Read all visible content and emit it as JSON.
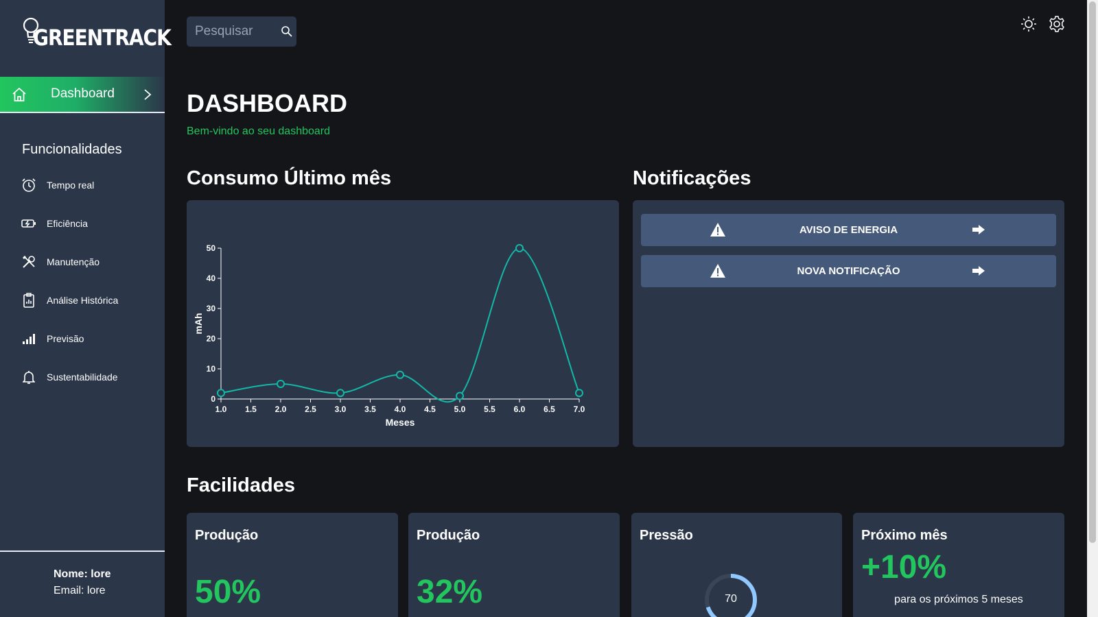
{
  "app": {
    "logo_text": "GREENTRACK"
  },
  "sidebar": {
    "active_item": {
      "label": "Dashboard",
      "icon": "home-icon"
    },
    "section_title": "Funcionalidades",
    "items": [
      {
        "label": "Tempo real",
        "icon": "alarm-clock-icon"
      },
      {
        "label": "Eficiência",
        "icon": "battery-charging-icon"
      },
      {
        "label": "Manutenção",
        "icon": "tools-icon"
      },
      {
        "label": "Análise Histórica",
        "icon": "clipboard-icon"
      },
      {
        "label": "Previsão",
        "icon": "signal-bars-icon"
      },
      {
        "label": "Sustentabilidade",
        "icon": "bell-icon"
      }
    ],
    "user": {
      "name_line": "Nome: lore",
      "email_line": "Email: lore"
    }
  },
  "topbar": {
    "search_placeholder": "Pesquisar",
    "icons": [
      "sun-icon",
      "gear-icon"
    ]
  },
  "header": {
    "title": "DASHBOARD",
    "subtitle": "Bem-vindo ao seu dashboard"
  },
  "consumo": {
    "title": "Consumo Último mês"
  },
  "chart_data": {
    "type": "line",
    "title": "",
    "xlabel": "Meses",
    "ylabel": "mAh",
    "x": [
      1,
      2,
      3,
      4,
      5,
      6,
      7
    ],
    "series": [
      {
        "values": [
          2,
          5,
          2,
          8,
          1,
          50,
          2
        ]
      }
    ],
    "xlim": [
      1,
      7
    ],
    "ylim": [
      0,
      50
    ],
    "x_ticks": [
      "1.0",
      "1.5",
      "2.0",
      "2.5",
      "3.0",
      "3.5",
      "4.0",
      "4.5",
      "5.0",
      "5.5",
      "6.0",
      "6.5",
      "7.0"
    ],
    "y_ticks": [
      "0",
      "10",
      "20",
      "30",
      "40",
      "50"
    ],
    "grid": false,
    "line_color": "#14b8a6"
  },
  "notificacoes": {
    "title": "Notificações",
    "items": [
      {
        "label": "AVISO DE ENERGIA",
        "icon": "warning-icon",
        "action_icon": "arrow-right-icon"
      },
      {
        "label": "NOVA NOTIFICAÇÃO",
        "icon": "warning-icon",
        "action_icon": "arrow-right-icon"
      }
    ]
  },
  "facilidades": {
    "title": "Facilidades",
    "cards": [
      {
        "title": "Produção",
        "value": "50%"
      },
      {
        "title": "Produção",
        "value": "32%"
      },
      {
        "title": "Pressão",
        "gauge_value": "70",
        "gauge_fraction": 0.7
      },
      {
        "title": "Próximo mês",
        "value": "+10%",
        "note": "para os próximos 5 meses"
      }
    ]
  },
  "colors": {
    "accent": "#22c55e",
    "panel": "#2b3649",
    "background": "#141519",
    "notif_bg": "#45597a",
    "gauge": "#90c8ff"
  }
}
